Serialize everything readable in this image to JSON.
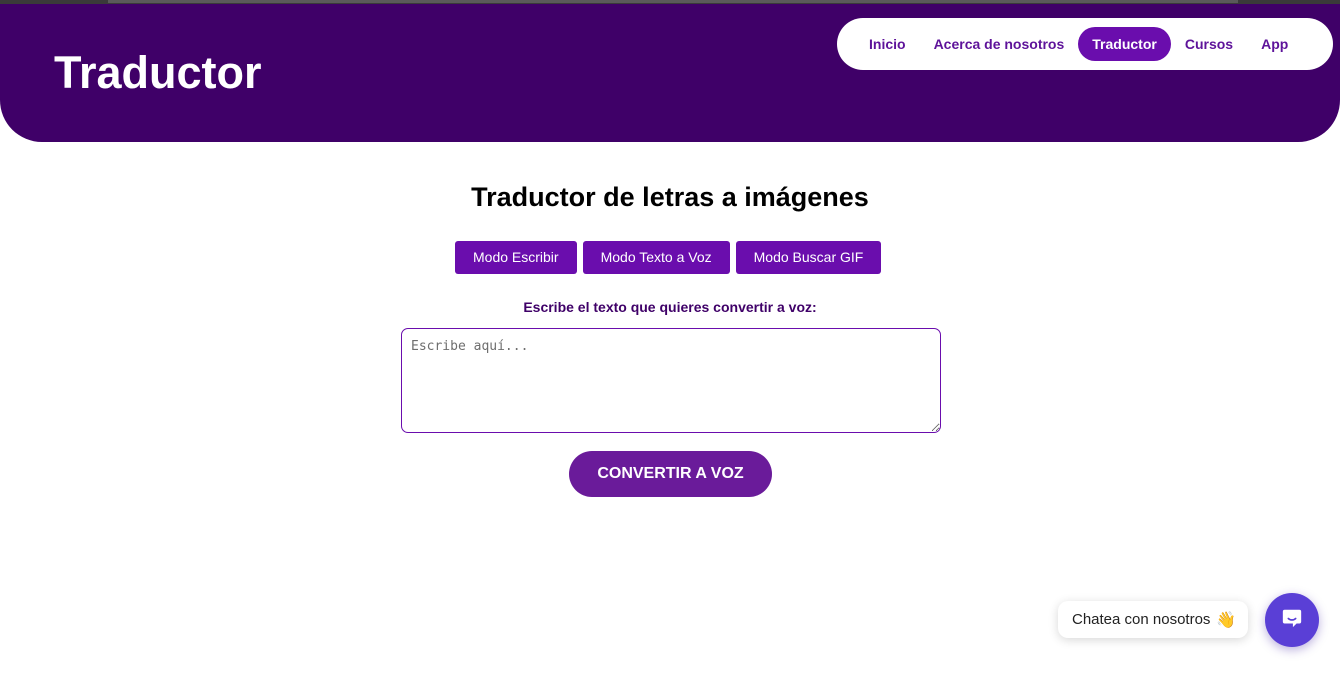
{
  "header": {
    "title": "Traductor",
    "nav": [
      {
        "label": "Inicio",
        "active": false
      },
      {
        "label": "Acerca de nosotros",
        "active": false
      },
      {
        "label": "Traductor",
        "active": true
      },
      {
        "label": "Cursos",
        "active": false
      },
      {
        "label": "App",
        "active": false
      }
    ]
  },
  "main": {
    "title": "Traductor de letras a imágenes",
    "modes": [
      "Modo Escribir",
      "Modo Texto a Voz",
      "Modo Buscar GIF"
    ],
    "prompt": "Escribe el texto que quieres convertir a voz:",
    "input": {
      "value": "",
      "placeholder": "Escribe aquí..."
    },
    "convert_label": "CONVERTIR A VOZ"
  },
  "chat": {
    "bubble_label": "Chatea con nosotros",
    "bubble_icon": "waving-hand-icon",
    "launcher_icon": "chat-icon"
  },
  "colors": {
    "header_bg": "#3f0068",
    "accent": "#6a0dad",
    "button": "#6a1b9a",
    "chat_launcher": "#5a3fd6"
  }
}
